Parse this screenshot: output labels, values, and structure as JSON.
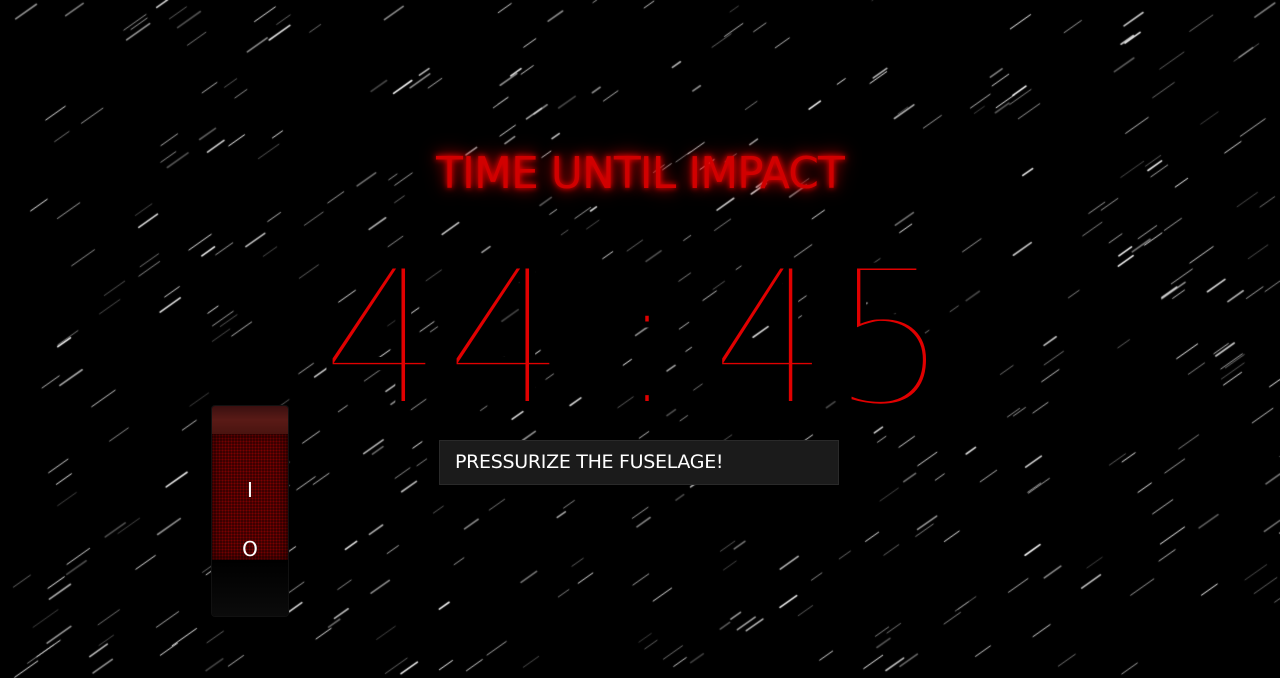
{
  "title": "TIME UNTIL IMPACT",
  "timer": {
    "minutes": "44",
    "separator": ":",
    "seconds": "45"
  },
  "switch": {
    "on_label": "I",
    "off_label": "O"
  },
  "command": {
    "text": "PRESSURIZE THE FUSELAGE!"
  },
  "colors": {
    "accent": "#e00000",
    "background": "#000000",
    "command_bg": "#1b1b1b"
  }
}
